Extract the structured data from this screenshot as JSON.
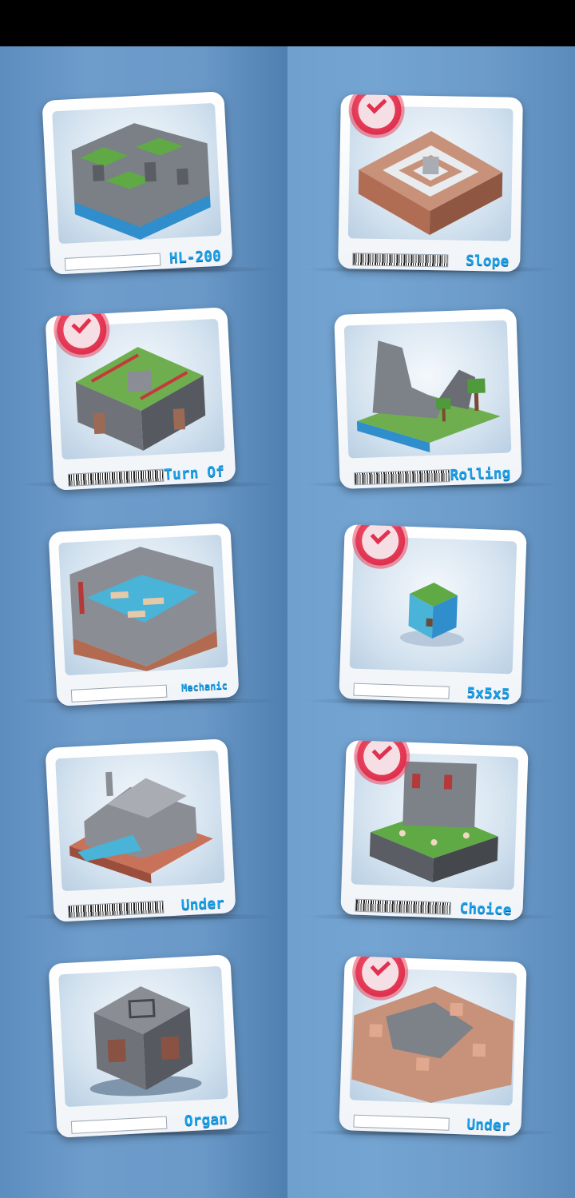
{
  "levels": [
    {
      "title": "HL-200",
      "completed": false,
      "qr_visible": false,
      "scene": "castle-water"
    },
    {
      "title": "Slope",
      "completed": true,
      "qr_visible": true,
      "scene": "brick-maze"
    },
    {
      "title": "Turn Of",
      "completed": true,
      "qr_visible": true,
      "scene": "grass-fortress"
    },
    {
      "title": "Rolling",
      "completed": false,
      "qr_visible": true,
      "scene": "stone-ruin-trees"
    },
    {
      "title": "Mechanic",
      "completed": false,
      "qr_visible": false,
      "scene": "castle-pool"
    },
    {
      "title": "5x5x5",
      "completed": true,
      "qr_visible": false,
      "scene": "small-cube"
    },
    {
      "title": "Under",
      "completed": false,
      "qr_visible": true,
      "scene": "stone-hall"
    },
    {
      "title": "Choice",
      "completed": true,
      "qr_visible": true,
      "scene": "grass-tower"
    },
    {
      "title": "Organ",
      "completed": false,
      "qr_visible": false,
      "scene": "stone-cube"
    },
    {
      "title": "Under",
      "completed": true,
      "qr_visible": false,
      "scene": "brick-ruins"
    }
  ],
  "colors": {
    "title": "#1aa0e8",
    "badge": "#e0314f",
    "panel_left": "#6a99c8",
    "panel_right": "#74a4d2"
  },
  "icons": {
    "completed": "check-badge-icon"
  }
}
